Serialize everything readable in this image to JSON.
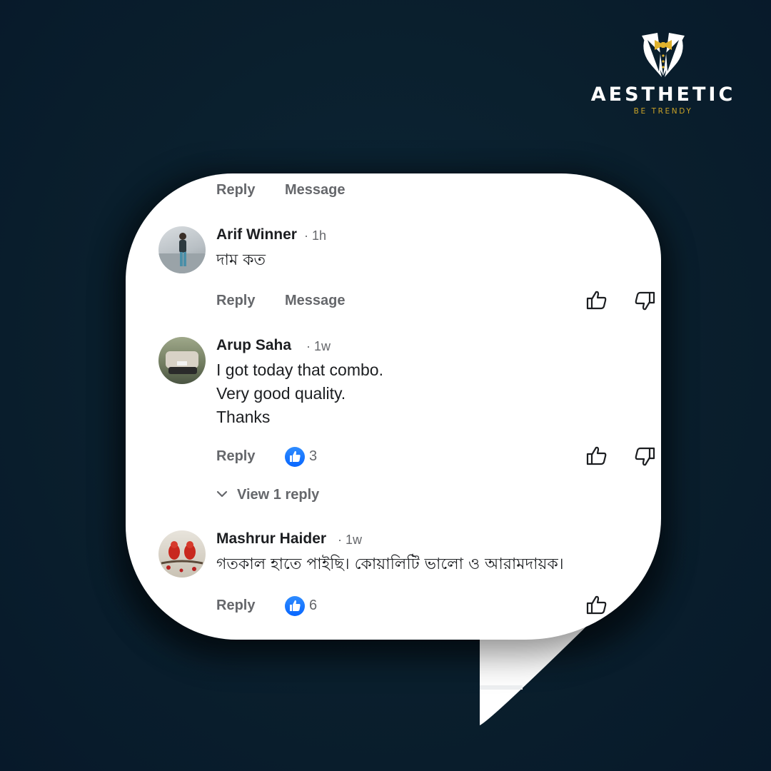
{
  "brand": {
    "name": "AESTHETIC",
    "tagline": "BE TRENDY",
    "icon": "tuxedo-bowtie-icon",
    "accent": "#c9a227"
  },
  "colors": {
    "background": "#0a1f2d",
    "bubble": "#ffffff",
    "text": "#1c1e21",
    "secondary_text": "#65676b",
    "like_blue": "#0866ff"
  },
  "top_actions": {
    "reply": "Reply",
    "message": "Message"
  },
  "comments": [
    {
      "author": "Arif Winner",
      "time": "· 1h",
      "text": [
        "দাম কত"
      ],
      "actions": {
        "reply": "Reply",
        "message": "Message"
      },
      "icons": [
        "thumbs-up-icon",
        "thumbs-down-icon"
      ]
    },
    {
      "author": "Arup Saha",
      "time": "· 1w",
      "text": [
        "I got today that combo.",
        "Very good quality.",
        "Thanks"
      ],
      "actions": {
        "reply": "Reply"
      },
      "like_count": "3",
      "view_replies": "View 1 reply",
      "icons": [
        "thumbs-up-icon",
        "thumbs-down-icon"
      ]
    },
    {
      "author": "Mashrur Haider",
      "time": "· 1w",
      "text": [
        "গতকাল হাতে পাইছি। কোয়ালিটি ভালো ও আরামদায়ক।"
      ],
      "actions": {
        "reply": "Reply"
      },
      "like_count": "6",
      "icons": [
        "thumbs-up-icon"
      ]
    }
  ]
}
